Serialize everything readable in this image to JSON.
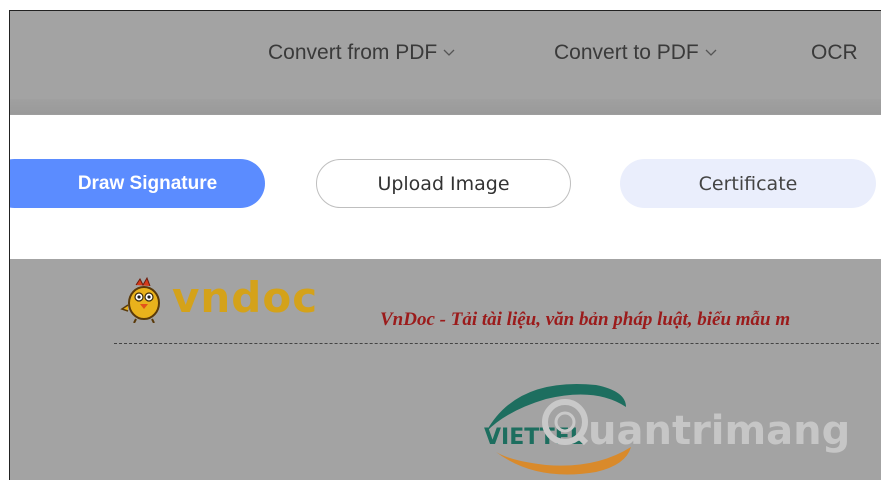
{
  "nav": {
    "items": [
      {
        "label": "Convert from PDF",
        "has_dropdown": true
      },
      {
        "label": "Convert to PDF",
        "has_dropdown": true
      },
      {
        "label": "OCR",
        "has_dropdown": false
      }
    ]
  },
  "signature": {
    "draw_label": "Draw Signature",
    "upload_label": "Upload Image",
    "certificate_label": "Certificate",
    "active_tab": "Draw Signature"
  },
  "document": {
    "logo_text": "vndoc",
    "header_text": "VnDoc - Tải tài liệu, văn bản pháp luật, biểu mẫu m",
    "watermark_text": "uantrimang",
    "emblem_text": "VIETTEL"
  },
  "colors": {
    "primary": "#5b8cff",
    "certificate_bg": "#eaeefc",
    "overlay": "#a3a3a3",
    "vndoc_gold": "#d4a21a",
    "header_red": "#9b1b1b",
    "viettel_green": "#1d6e5f",
    "viettel_orange": "#d98a2b"
  }
}
